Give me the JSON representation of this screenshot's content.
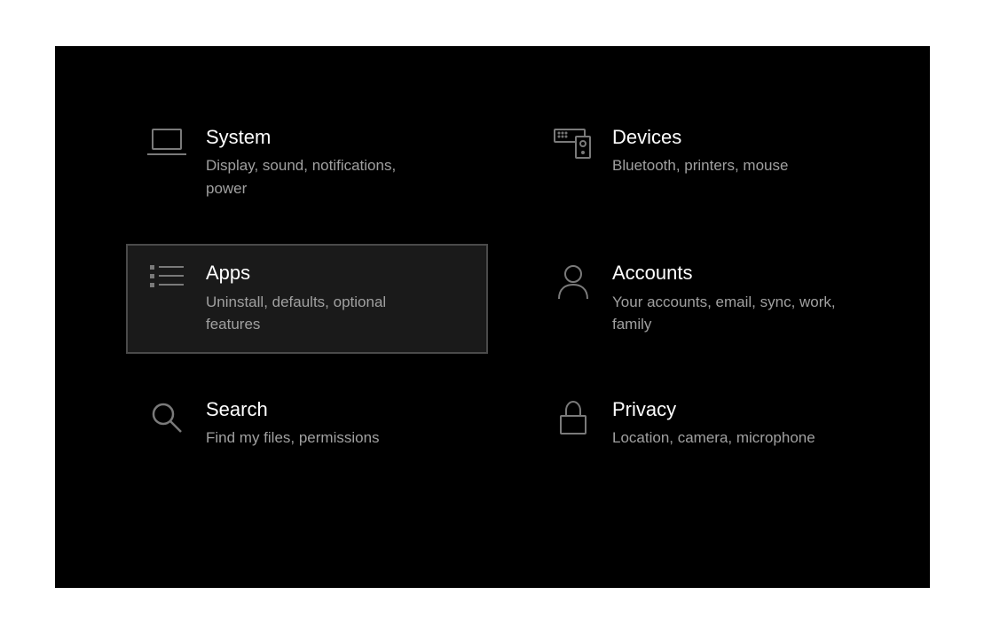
{
  "tiles": [
    {
      "id": "system",
      "title": "System",
      "desc": "Display, sound, notifications, power",
      "icon": "laptop-icon",
      "selected": false
    },
    {
      "id": "devices",
      "title": "Devices",
      "desc": "Bluetooth, printers, mouse",
      "icon": "devices-icon",
      "selected": false
    },
    {
      "id": "apps",
      "title": "Apps",
      "desc": "Uninstall, defaults, optional features",
      "icon": "list-icon",
      "selected": true
    },
    {
      "id": "accounts",
      "title": "Accounts",
      "desc": "Your accounts, email, sync, work, family",
      "icon": "person-icon",
      "selected": false
    },
    {
      "id": "search",
      "title": "Search",
      "desc": "Find my files, permissions",
      "icon": "search-icon",
      "selected": false
    },
    {
      "id": "privacy",
      "title": "Privacy",
      "desc": "Location, camera, microphone",
      "icon": "lock-icon",
      "selected": false
    }
  ]
}
